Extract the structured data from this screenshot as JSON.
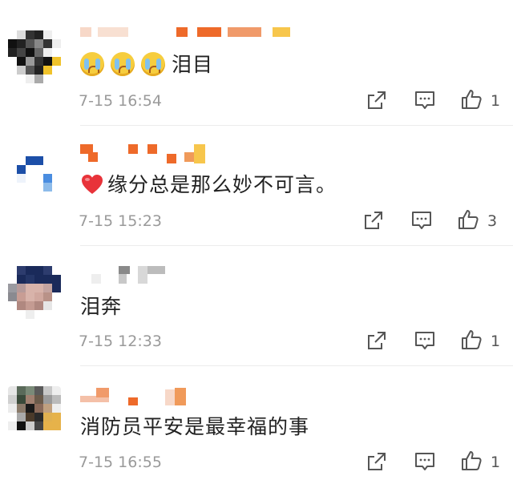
{
  "colors": {
    "text": "#222222",
    "time": "#9a9a9a",
    "icon": "#555555",
    "divider": "#ececec",
    "heart": "#e8333a",
    "emoji": "#f6cd3e"
  },
  "icons": {
    "repost": "share-arrow-box-icon",
    "comment": "comment-bubble-icon",
    "like": "thumbs-up-icon"
  },
  "comments": [
    {
      "emoji": "crying-face-icon",
      "emoji_count": 3,
      "text": "泪目",
      "time": "7-15 16:54",
      "likes": "1"
    },
    {
      "emoji": "red-heart-icon",
      "text": "缘分总是那么妙不可言。",
      "time": "7-15 15:23",
      "likes": "3"
    },
    {
      "text": "泪奔",
      "time": "7-15 12:33",
      "likes": "1"
    },
    {
      "text": "消防员平安是最幸福的事",
      "time": "7-15 16:55",
      "likes": "1"
    }
  ]
}
